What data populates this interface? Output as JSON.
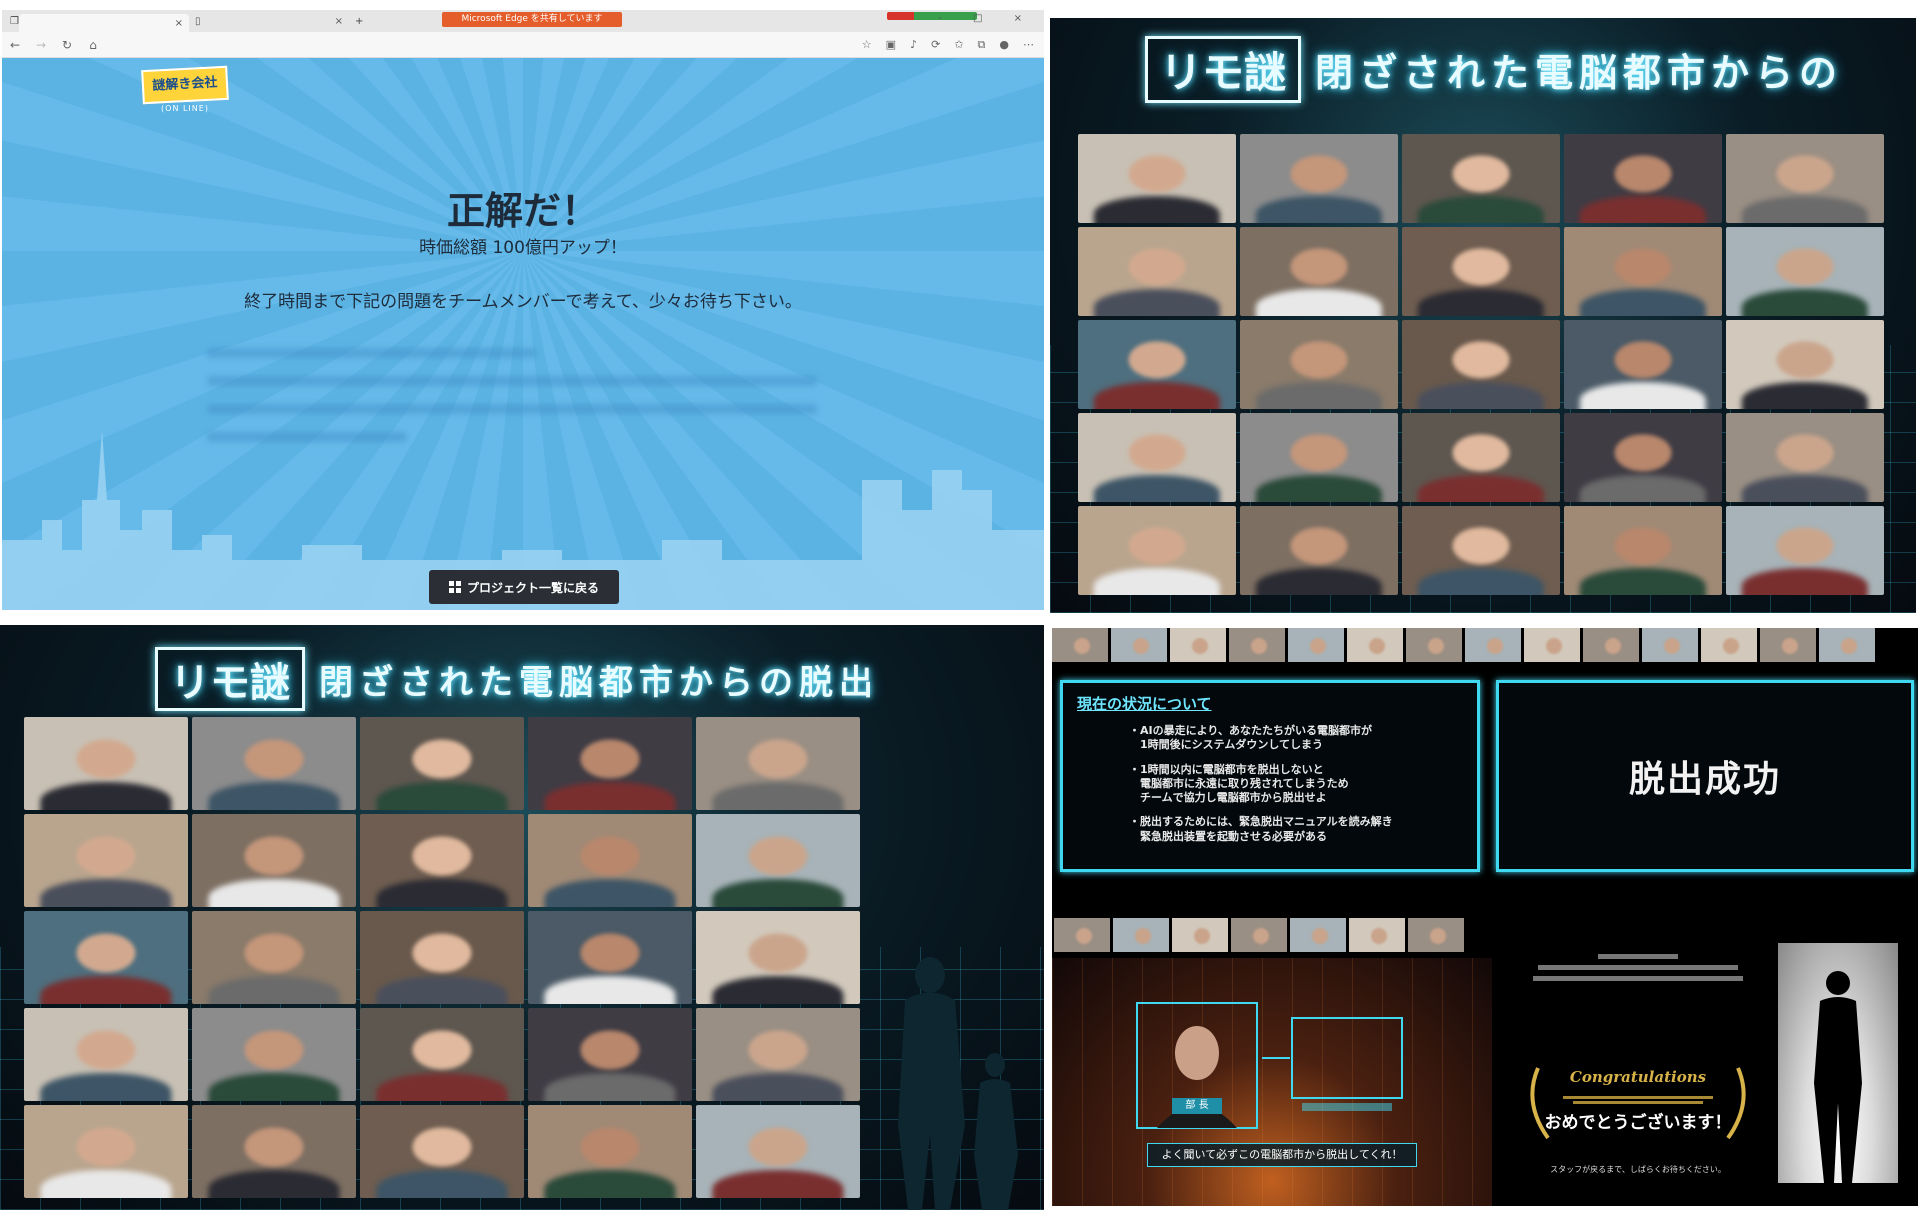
{
  "browser": {
    "tabs": [
      {
        "label": ""
      },
      {
        "label": ""
      }
    ],
    "tab_banner": "Microsoft Edge を共有しています",
    "window_controls": "- □ ×"
  },
  "game_page": {
    "logo": {
      "title": "謎解き会社",
      "subtitle": "(ON LINE)"
    },
    "title": "正解だ！",
    "subtitle": "時価総額 100億円アップ！",
    "message": "終了時間まで下記の問題をチームメンバーで考えて、少々お待ち下さい。",
    "back_button": "プロジェクト一覧に戻る"
  },
  "event": {
    "logo": "リモ謎",
    "title_q2": "閉ざされた電脳都市からの",
    "title_q3": "閉ざされた電脳都市からの脱出"
  },
  "status_slide": {
    "heading": "現在の状況について",
    "items": [
      "・AIの暴走により、あなたたちがいる電脳都市が\n　1時間後にシステムダウンしてしまう",
      "・1時間以内に電脳都市を脱出しないと\n　電脳都市に永遠に取り残されてしまうため\n　チームで協力し電脳都市から脱出せよ",
      "・脱出するためには、緊急脱出マニュアルを読み解き\n　緊急脱出装置を起動させる必要がある"
    ]
  },
  "escape_slide": {
    "text": "脱出成功"
  },
  "dialog_slide": {
    "chief_label": "部 長",
    "line": "よく聞いて必ずこの電脳都市から脱出してくれ！"
  },
  "congrats_slide": {
    "script": "Congratulations",
    "main": "おめでとうございます！",
    "footer": "スタッフが戻るまで、しばらくお待ちください。"
  },
  "colors": {
    "page_blue": "#5bb3e4",
    "neon_cyan": "#40d8f0",
    "button_dark": "#2b2f35",
    "gold": "#d8b34a"
  }
}
